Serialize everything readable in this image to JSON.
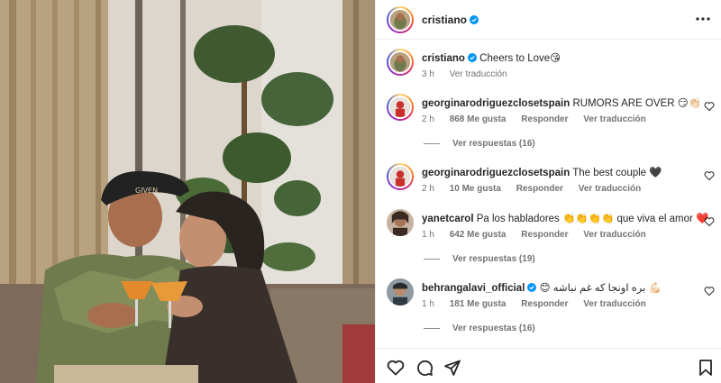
{
  "post": {
    "author": "cristiano",
    "caption": "Cheers to Love😘",
    "time": "3 h",
    "translate": "Ver traducción"
  },
  "comments": [
    {
      "user": "georginarodriguezclosetspain",
      "text": "RUMORS ARE OVER 😏👏🏻",
      "time": "2 h",
      "likes": "868 Me gusta",
      "reply": "Responder",
      "translate": "Ver traducción",
      "replies": "Ver respuestas (16)",
      "verified": false,
      "avatar_ring": true
    },
    {
      "user": "georginarodriguezclosetspain",
      "text": "The best couple 🖤",
      "time": "2 h",
      "likes": "10 Me gusta",
      "reply": "Responder",
      "translate": "Ver traducción",
      "replies": "",
      "verified": false,
      "avatar_ring": true
    },
    {
      "user": "yanetcarol",
      "text": "Pa los habladores 👏👏👏👏 que viva el amor ❤️",
      "time": "1 h",
      "likes": "642 Me gusta",
      "reply": "Responder",
      "translate": "Ver traducción",
      "replies": "Ver respuestas (19)",
      "verified": false,
      "avatar_ring": false
    },
    {
      "user": "behrangalavi_official",
      "text": "😊 بره اونجا که غم نباشه 💪🏻",
      "time": "1 h",
      "likes": "181 Me gusta",
      "reply": "Responder",
      "translate": "Ver traducción",
      "replies": "Ver respuestas (16)",
      "verified": true,
      "avatar_ring": false
    }
  ],
  "icons": {
    "more": "more-options-icon",
    "like": "heart-icon",
    "comment": "comment-icon",
    "share": "share-icon",
    "save": "bookmark-icon",
    "verified": "verified-badge-icon"
  },
  "colors": {
    "verified": "#0095f6",
    "text": "#262626",
    "muted": "#737373",
    "divider": "#efefef"
  }
}
